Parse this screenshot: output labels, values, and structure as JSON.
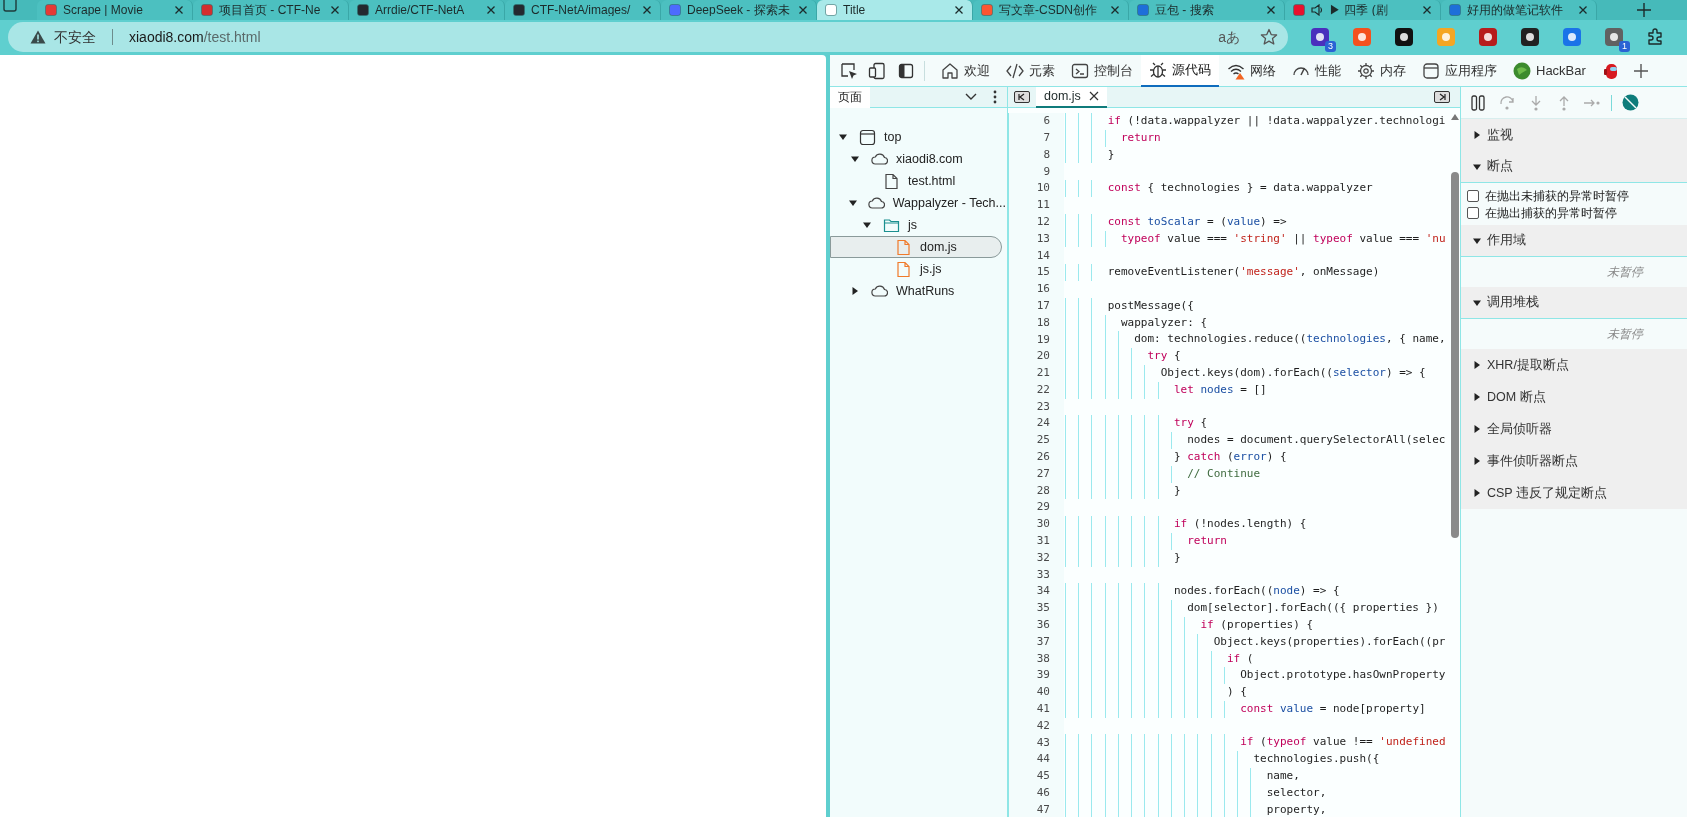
{
  "browser_tabs": [
    {
      "title": "Scrape | Movie",
      "selected": false,
      "audio": false,
      "color": "#e53935"
    },
    {
      "title": "项目首页 - CTF-Ne",
      "selected": false,
      "audio": false,
      "color": "#d32f2f"
    },
    {
      "title": "Arrdie/CTF-NetA",
      "selected": false,
      "audio": false,
      "color": "#24292f"
    },
    {
      "title": "CTF-NetA/images/",
      "selected": false,
      "audio": false,
      "color": "#24292f"
    },
    {
      "title": "DeepSeek - 探索未",
      "selected": false,
      "audio": false,
      "color": "#4d6bfe"
    },
    {
      "title": "Title",
      "selected": true,
      "audio": false,
      "color": "#ffffff"
    },
    {
      "title": "写文章-CSDN创作",
      "selected": false,
      "audio": false,
      "color": "#fc5531"
    },
    {
      "title": "豆包 - 搜索",
      "selected": false,
      "audio": false,
      "color": "#1e6fd9"
    },
    {
      "title": "▶ 四季 (剧",
      "selected": false,
      "audio": true,
      "color": "#e8112d"
    },
    {
      "title": "好用的做笔记软件",
      "selected": false,
      "audio": false,
      "color": "#1e6fd9"
    }
  ],
  "address_bar": {
    "security": "不安全",
    "host": "xiaodi8.com",
    "path": "/test.html",
    "reader": "aあ"
  },
  "extensions": [
    {
      "color": "#4a2fbd",
      "badge": "3"
    },
    {
      "color": "#f4511e"
    },
    {
      "color": "#111111"
    },
    {
      "color": "#f5a623"
    },
    {
      "color": "#b71c1c"
    },
    {
      "color": "#212121"
    },
    {
      "color": "#1a73e8"
    },
    {
      "color": "#616161",
      "badge": "1"
    }
  ],
  "devtools": {
    "tabs": [
      {
        "kind": "home",
        "label": "欢迎",
        "selected": false
      },
      {
        "kind": "code",
        "label": "元素",
        "selected": false
      },
      {
        "kind": "console",
        "label": "控制台",
        "selected": false
      },
      {
        "kind": "bug",
        "label": "源代码",
        "selected": true
      },
      {
        "kind": "wifi",
        "label": "网络",
        "selected": false
      },
      {
        "kind": "gauge",
        "label": "性能",
        "selected": false
      },
      {
        "kind": "chip",
        "label": "内存",
        "selected": false
      },
      {
        "kind": "window",
        "label": "应用程序",
        "selected": false
      },
      {
        "kind": "ball",
        "label": "HackBar",
        "selected": false
      },
      {
        "kind": "figure",
        "selected": false
      }
    ],
    "navigator": {
      "tab": "页面",
      "tree": [
        {
          "kind": "frame",
          "label": "top",
          "expanded": true,
          "selected": false,
          "children": [
            {
              "kind": "domain",
              "label": "xiaodi8.com",
              "expanded": true,
              "selected": false,
              "children": [
                {
                  "kind": "file",
                  "label": "test.html",
                  "selected": false
                }
              ]
            },
            {
              "kind": "domain",
              "label": "Wappalyzer - Tech...",
              "expanded": true,
              "selected": false,
              "children": [
                {
                  "kind": "folder",
                  "label": "js",
                  "expanded": true,
                  "selected": false,
                  "children": [
                    {
                      "kind": "script",
                      "label": "dom.js",
                      "selected": true
                    },
                    {
                      "kind": "script",
                      "label": "js.js",
                      "selected": false
                    }
                  ]
                }
              ]
            },
            {
              "kind": "domain",
              "label": "WhatRuns",
              "expanded": false,
              "selected": false
            }
          ]
        }
      ]
    },
    "editor": {
      "tabs": [
        {
          "label": "dom.js",
          "selected": true
        }
      ],
      "lines": [
        {
          "number": "6",
          "tokens": [
            {
              "kind": "keyword",
              "text": "      if"
            },
            {
              "kind": "plain",
              "text": " (!data.wappalyzer || !data.wappalyzer.technologi"
            }
          ]
        },
        {
          "number": "7",
          "tokens": [
            {
              "kind": "keyword",
              "text": "        return"
            }
          ]
        },
        {
          "number": "8",
          "tokens": [
            {
              "kind": "plain",
              "text": "      }"
            }
          ]
        },
        {
          "number": "9"
        },
        {
          "number": "10",
          "tokens": [
            {
              "kind": "keyword",
              "text": "      const"
            },
            {
              "kind": "plain",
              "text": " { technologies } = data.wappalyzer"
            }
          ]
        },
        {
          "number": "11"
        },
        {
          "number": "12",
          "tokens": [
            {
              "kind": "keyword",
              "text": "      const"
            },
            {
              "kind": "variable",
              "text": " toScalar"
            },
            {
              "kind": "plain",
              "text": " = ("
            },
            {
              "kind": "variable",
              "text": "value"
            },
            {
              "kind": "plain",
              "text": ") =>"
            }
          ]
        },
        {
          "number": "13",
          "tokens": [
            {
              "kind": "keyword",
              "text": "        typeof"
            },
            {
              "kind": "plain",
              "text": " value === "
            },
            {
              "kind": "string",
              "text": "'string'"
            },
            {
              "kind": "plain",
              "text": " || "
            },
            {
              "kind": "keyword",
              "text": "typeof"
            },
            {
              "kind": "plain",
              "text": " value === "
            },
            {
              "kind": "string",
              "text": "'nu"
            }
          ]
        },
        {
          "number": "14"
        },
        {
          "number": "15",
          "tokens": [
            {
              "kind": "plain",
              "text": "      removeEventListener("
            },
            {
              "kind": "string",
              "text": "'message'"
            },
            {
              "kind": "plain",
              "text": ", onMessage)"
            }
          ]
        },
        {
          "number": "16"
        },
        {
          "number": "17",
          "tokens": [
            {
              "kind": "plain",
              "text": "      postMessage({"
            }
          ]
        },
        {
          "number": "18",
          "tokens": [
            {
              "kind": "plain",
              "text": "        wappalyzer: {"
            }
          ]
        },
        {
          "number": "19",
          "tokens": [
            {
              "kind": "plain",
              "text": "          dom: technologies.reduce(("
            },
            {
              "kind": "variable",
              "text": "technologies"
            },
            {
              "kind": "plain",
              "text": ", { name,"
            }
          ]
        },
        {
          "number": "20",
          "tokens": [
            {
              "kind": "keyword",
              "text": "            try"
            },
            {
              "kind": "plain",
              "text": " {"
            }
          ]
        },
        {
          "number": "21",
          "tokens": [
            {
              "kind": "plain",
              "text": "              Object.keys(dom).forEach(("
            },
            {
              "kind": "variable",
              "text": "selector"
            },
            {
              "kind": "plain",
              "text": ") => {"
            }
          ]
        },
        {
          "number": "22",
          "tokens": [
            {
              "kind": "keyword",
              "text": "                let"
            },
            {
              "kind": "variable",
              "text": " nodes"
            },
            {
              "kind": "plain",
              "text": " = []"
            }
          ]
        },
        {
          "number": "23"
        },
        {
          "number": "24",
          "tokens": [
            {
              "kind": "keyword",
              "text": "                try"
            },
            {
              "kind": "plain",
              "text": " {"
            }
          ]
        },
        {
          "number": "25",
          "tokens": [
            {
              "kind": "plain",
              "text": "                  nodes = document.querySelectorAll(selec"
            }
          ]
        },
        {
          "number": "26",
          "tokens": [
            {
              "kind": "plain",
              "text": "                } "
            },
            {
              "kind": "keyword",
              "text": "catch"
            },
            {
              "kind": "plain",
              "text": " ("
            },
            {
              "kind": "variable",
              "text": "error"
            },
            {
              "kind": "plain",
              "text": ") {"
            }
          ]
        },
        {
          "number": "27",
          "tokens": [
            {
              "kind": "comment",
              "text": "                  // Continue"
            }
          ]
        },
        {
          "number": "28",
          "tokens": [
            {
              "kind": "plain",
              "text": "                }"
            }
          ]
        },
        {
          "number": "29"
        },
        {
          "number": "30",
          "tokens": [
            {
              "kind": "keyword",
              "text": "                if"
            },
            {
              "kind": "plain",
              "text": " (!nodes.length) {"
            }
          ]
        },
        {
          "number": "31",
          "tokens": [
            {
              "kind": "keyword",
              "text": "                  return"
            }
          ]
        },
        {
          "number": "32",
          "tokens": [
            {
              "kind": "plain",
              "text": "                }"
            }
          ]
        },
        {
          "number": "33"
        },
        {
          "number": "34",
          "tokens": [
            {
              "kind": "plain",
              "text": "                nodes.forEach(("
            },
            {
              "kind": "variable",
              "text": "node"
            },
            {
              "kind": "plain",
              "text": ") => {"
            }
          ]
        },
        {
          "number": "35",
          "tokens": [
            {
              "kind": "plain",
              "text": "                  dom[selector].forEach(({ properties })"
            }
          ]
        },
        {
          "number": "36",
          "tokens": [
            {
              "kind": "keyword",
              "text": "                    if"
            },
            {
              "kind": "plain",
              "text": " (properties) {"
            }
          ]
        },
        {
          "number": "37",
          "tokens": [
            {
              "kind": "plain",
              "text": "                      Object.keys(properties).forEach((pr"
            }
          ]
        },
        {
          "number": "38",
          "tokens": [
            {
              "kind": "keyword",
              "text": "                        if"
            },
            {
              "kind": "plain",
              "text": " ("
            }
          ]
        },
        {
          "number": "39",
          "tokens": [
            {
              "kind": "plain",
              "text": "                          Object.prototype.hasOwnProperty"
            }
          ]
        },
        {
          "number": "40",
          "tokens": [
            {
              "kind": "plain",
              "text": "                        ) {"
            }
          ]
        },
        {
          "number": "41",
          "tokens": [
            {
              "kind": "keyword",
              "text": "                          const"
            },
            {
              "kind": "variable",
              "text": " value"
            },
            {
              "kind": "plain",
              "text": " = node[property]"
            }
          ]
        },
        {
          "number": "42"
        },
        {
          "number": "43",
          "tokens": [
            {
              "kind": "keyword",
              "text": "                          if"
            },
            {
              "kind": "plain",
              "text": " ("
            },
            {
              "kind": "keyword",
              "text": "typeof"
            },
            {
              "kind": "plain",
              "text": " value !== "
            },
            {
              "kind": "string",
              "text": "'undefined"
            }
          ]
        },
        {
          "number": "44",
          "tokens": [
            {
              "kind": "plain",
              "text": "                            technologies.push({"
            }
          ]
        },
        {
          "number": "45",
          "tokens": [
            {
              "kind": "plain",
              "text": "                              name,"
            }
          ]
        },
        {
          "number": "46",
          "tokens": [
            {
              "kind": "plain",
              "text": "                              selector,"
            }
          ]
        },
        {
          "number": "47",
          "tokens": [
            {
              "kind": "plain",
              "text": "                              property,"
            }
          ]
        }
      ]
    },
    "debugger": {
      "sections": [
        {
          "title": "监视",
          "expanded": false
        },
        {
          "title": "断点",
          "expanded": true,
          "items": [
            {
              "kind": "checkbox",
              "label": "在抛出未捕获的异常时暂停",
              "checked": false
            },
            {
              "kind": "checkbox",
              "label": "在抛出捕获的异常时暂停",
              "checked": false
            }
          ]
        },
        {
          "title": "作用域",
          "expanded": true,
          "items": [
            {
              "kind": "message",
              "label": "未暂停"
            }
          ]
        },
        {
          "title": "调用堆栈",
          "expanded": true,
          "items": [
            {
              "kind": "message",
              "label": "未暂停"
            }
          ]
        },
        {
          "title": "XHR/提取断点",
          "expanded": false
        },
        {
          "title": "DOM 断点",
          "expanded": false
        },
        {
          "title": "全局侦听器",
          "expanded": false
        },
        {
          "title": "事件侦听器断点",
          "expanded": false
        },
        {
          "title": "CSP 违反了规定断点",
          "expanded": false
        }
      ]
    }
  }
}
